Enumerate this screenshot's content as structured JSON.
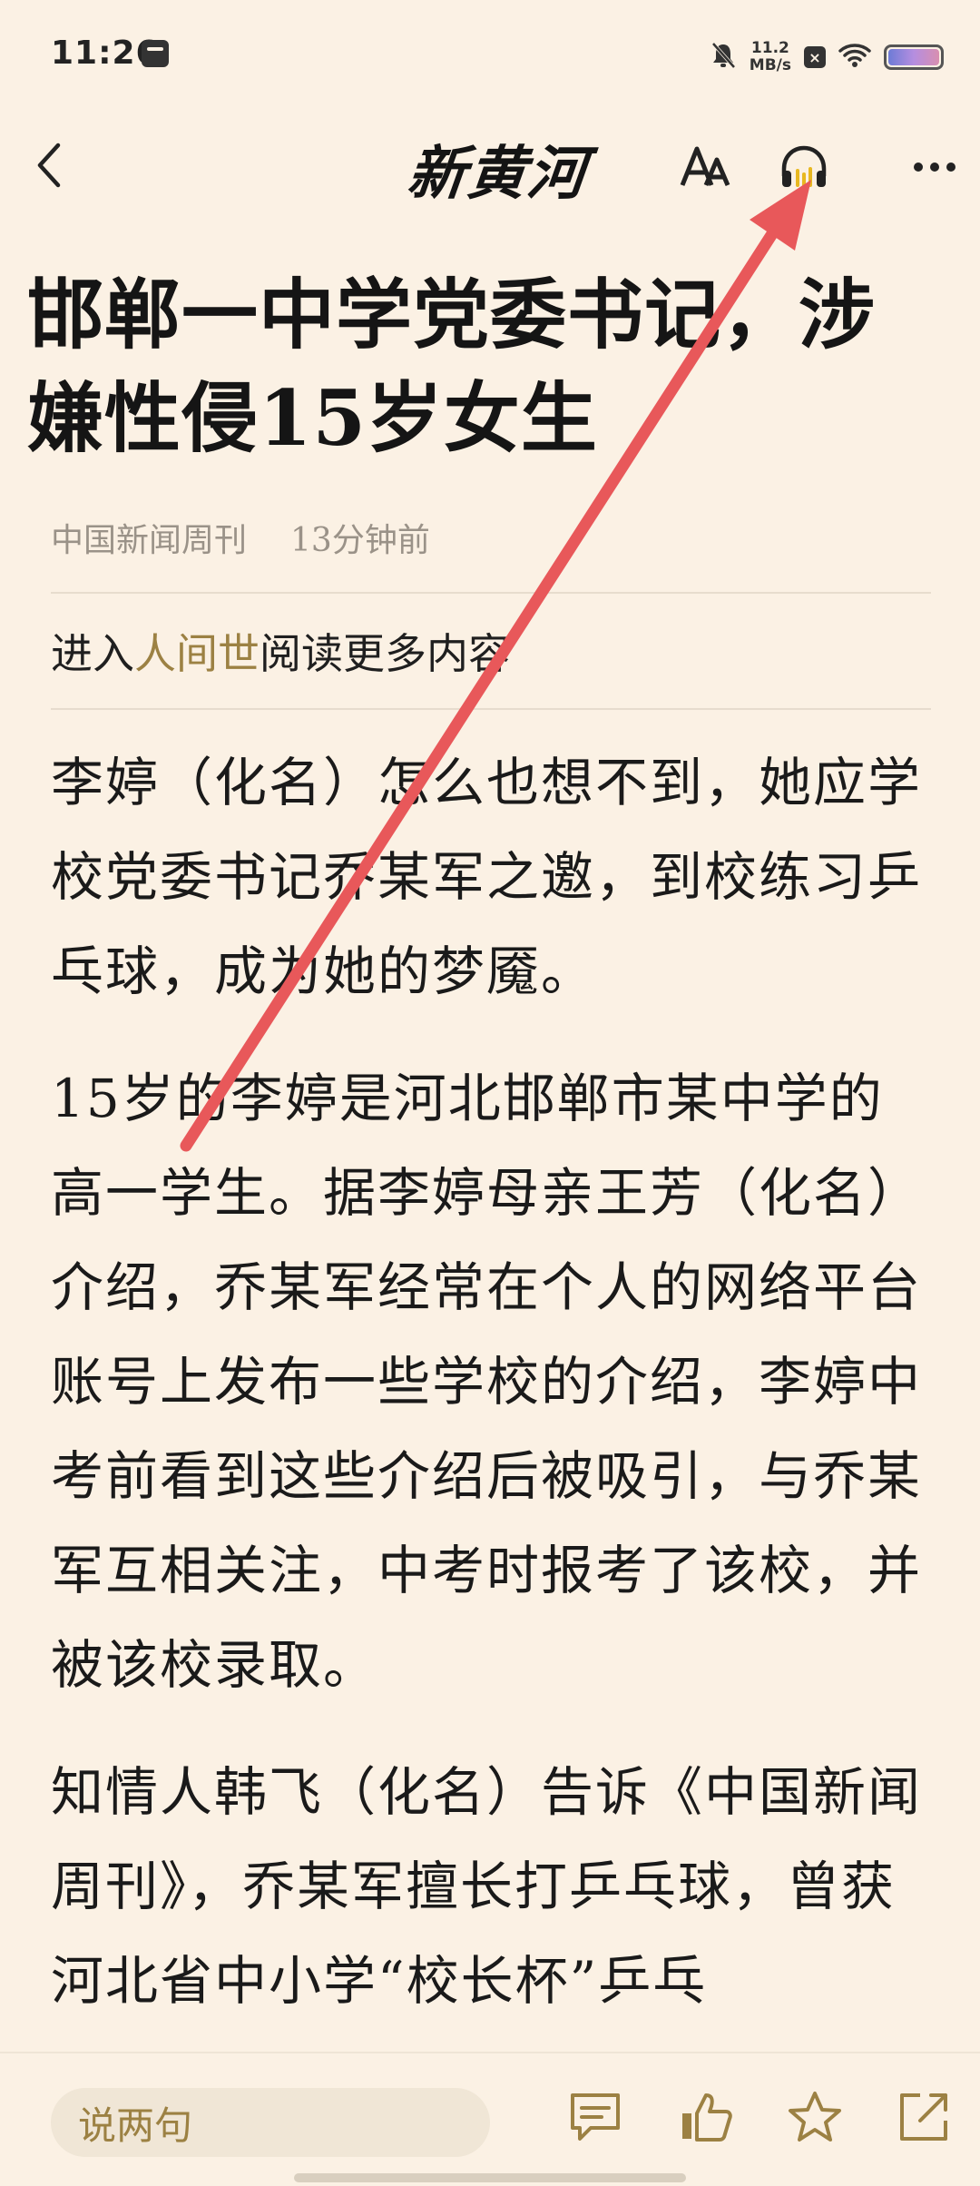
{
  "status_bar": {
    "time": "11:26",
    "speed_value": "11.2",
    "speed_unit": "MB/s",
    "icons": [
      "notification-icon",
      "mute-icon",
      "blocked-icon",
      "wifi-icon",
      "battery-icon"
    ]
  },
  "toolbar": {
    "brand": "新黄河",
    "icons": [
      "back-icon",
      "font-size-icon",
      "headphones-icon",
      "more-icon"
    ]
  },
  "article": {
    "title": "邯郸一中学党委书记，涉嫌性侵15岁女生",
    "source": "中国新闻周刊",
    "time_ago": "13分钟前",
    "promo_prefix": "进入",
    "promo_link": "人间世",
    "promo_suffix": "阅读更多内容",
    "paragraphs": [
      "李婷（化名）怎么也想不到，她应学校党委书记乔某军之邀，到校练习乒乓球，成为她的梦魇。",
      "15岁的李婷是河北邯郸市某中学的高一学生。据李婷母亲王芳（化名）介绍，乔某军经常在个人的网络平台账号上发布一些学校的介绍，李婷中考前看到这些介绍后被吸引，与乔某军互相关注，中考时报考了该校，并被该校录取。",
      "知情人韩飞（化名）告诉《中国新闻周刊》，乔某军擅长打乒乓球，曾获河北省中小学“校长杯”乒乓"
    ]
  },
  "bottom_bar": {
    "comment_placeholder": "说两句",
    "icons": [
      "comment-icon",
      "like-icon",
      "star-icon",
      "share-icon"
    ]
  },
  "colors": {
    "background": "#fbf1e4",
    "accent": "#9c8143",
    "annotation_arrow": "#e8585a",
    "headphones_accent": "#e8b820"
  }
}
